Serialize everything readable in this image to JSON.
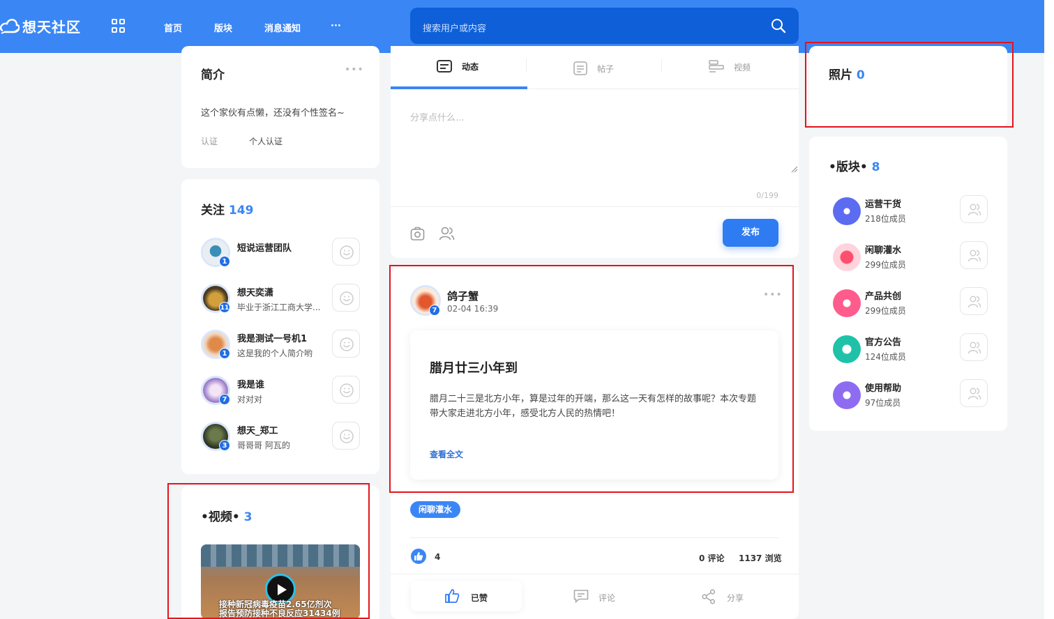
{
  "header": {
    "logo_text": "想天社区",
    "nav": [
      "首页",
      "版块",
      "消息通知",
      "···"
    ],
    "search_placeholder": "搜索用户或内容"
  },
  "intro": {
    "title": "简介",
    "signature": "这个家伙有点懒，还没有个性签名~",
    "cert_label": "认证",
    "cert_value": "个人认证"
  },
  "follow": {
    "title": "关注",
    "count": "149",
    "items": [
      {
        "name": "短说运营团队",
        "desc": "",
        "level": "1"
      },
      {
        "name": "想天奕潇",
        "desc": "毕业于浙江工商大学...",
        "level": "11"
      },
      {
        "name": "我是测试一号机1",
        "desc": "这是我的个人简介哟",
        "level": "1"
      },
      {
        "name": "我是谁",
        "desc": "对对对",
        "level": "7"
      },
      {
        "name": "想天_郑工",
        "desc": "哥哥哥 阿瓦的",
        "level": "3"
      }
    ]
  },
  "videos": {
    "title": "•视频•",
    "count": "3",
    "thumb_caption_1": "接种新冠病毒疫苗2.65亿剂次",
    "thumb_caption_2": "报告预防接种不良反应31434例"
  },
  "composer": {
    "tabs": [
      "动态",
      "帖子",
      "视频"
    ],
    "placeholder": "分享点什么...",
    "counter": "0/199",
    "publish": "发布"
  },
  "post": {
    "author": "鸽子蟹",
    "level": "7",
    "time": "02-04 16:39",
    "title": "腊月廿三小年到",
    "body": "腊月二十三是北方小年，算是过年的开端，那么这一天有怎样的故事呢？本次专题带大家走进北方小年，感受北方人民的热情吧！",
    "read_more": "查看全文",
    "tag": "闲聊灌水",
    "likes": "4",
    "comments": "0 评论",
    "views": "1137 浏览",
    "actions": [
      "已赞",
      "评论",
      "分享"
    ]
  },
  "photos": {
    "title": "照片",
    "count": "0"
  },
  "boards": {
    "title": "•版块•",
    "count": "8",
    "items": [
      {
        "name": "运营干货",
        "members": "218位成员",
        "color": "#5b6cf0"
      },
      {
        "name": "闲聊灌水",
        "members": "299位成员",
        "color": "#ff6b8a"
      },
      {
        "name": "产品共创",
        "members": "299位成员",
        "color": "#ff5c8d"
      },
      {
        "name": "官方公告",
        "members": "124位成员",
        "color": "#1fc2a8"
      },
      {
        "name": "使用帮助",
        "members": "97位成员",
        "color": "#8e6cf2"
      }
    ]
  },
  "colors": {
    "primary": "#3a86f5",
    "highlight_border": "#e3141c"
  }
}
